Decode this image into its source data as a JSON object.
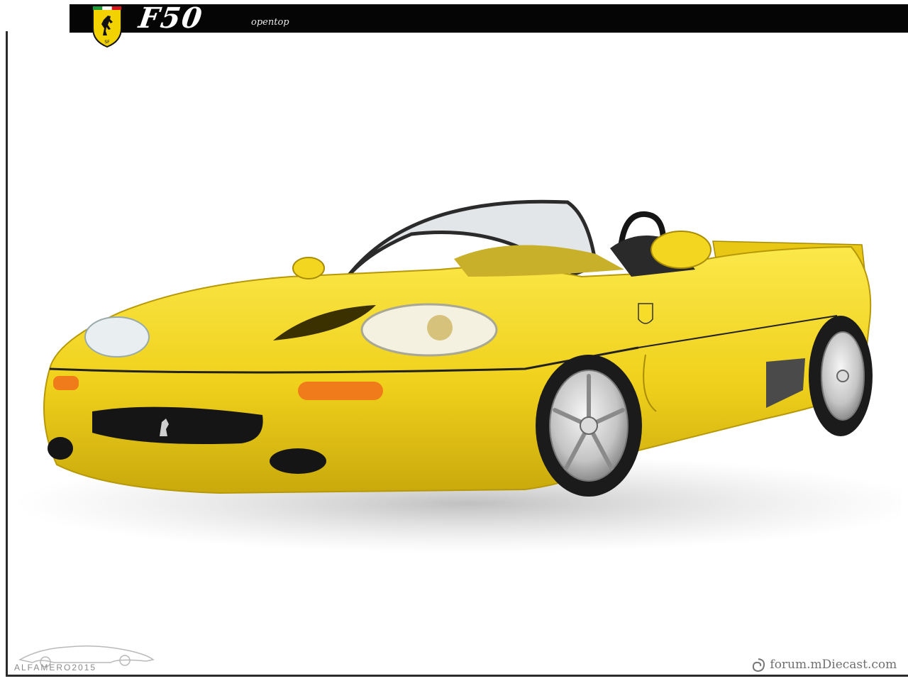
{
  "banner": {
    "model": "F50",
    "variant": "opentop",
    "logo": "prancing-horse-shield-logo",
    "background_color": "#050505"
  },
  "photo": {
    "subject": "yellow-convertible-supercar",
    "body_color": "#f0d11c",
    "background_color": "#ffffff"
  },
  "watermarks": {
    "left_text": "ALFAMERO2015",
    "right_text": "forum.mDiecast.com"
  }
}
